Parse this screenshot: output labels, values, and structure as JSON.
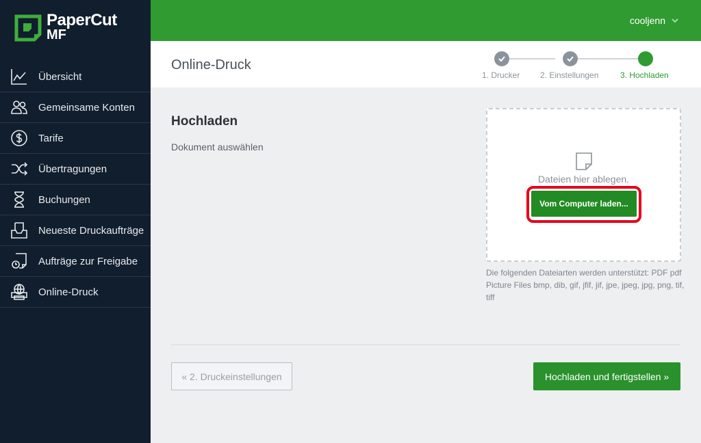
{
  "brand": {
    "name": "PaperCut",
    "product": "MF"
  },
  "user": {
    "name": "cooljenn"
  },
  "sidebar": {
    "items": [
      {
        "label": "Übersicht",
        "icon": "chart-line-icon"
      },
      {
        "label": "Gemeinsame Konten",
        "icon": "users-icon"
      },
      {
        "label": "Tarife",
        "icon": "dollar-icon"
      },
      {
        "label": "Übertragungen",
        "icon": "shuffle-icon"
      },
      {
        "label": "Buchungen",
        "icon": "hourglass-icon"
      },
      {
        "label": "Neueste Druckaufträge",
        "icon": "inbox-icon"
      },
      {
        "label": "Aufträge zur Freigabe",
        "icon": "document-release-icon"
      },
      {
        "label": "Online-Druck",
        "icon": "printer-globe-icon"
      }
    ]
  },
  "header": {
    "title": "Online-Druck",
    "steps": [
      {
        "label": "1. Drucker",
        "state": "done"
      },
      {
        "label": "2. Einstellungen",
        "state": "done"
      },
      {
        "label": "3. Hochladen",
        "state": "active"
      }
    ]
  },
  "main": {
    "title": "Hochladen",
    "subtitle": "Dokument auswählen",
    "dropzone": {
      "text": "Dateien hier ablegen.",
      "button": "Vom Computer laden..."
    },
    "filetypes": "Die folgenden Dateiarten werden unterstützt: PDF pdf Picture Files bmp, dib, gif, jfif, jif, jpe, jpeg, jpg, png, tif, tiff",
    "back_button": "« 2. Druckeinstellungen",
    "finish_button": "Hochladen und fertigstellen »"
  },
  "colors": {
    "brand_green": "#2f9b31",
    "sidebar_bg": "#111e2d",
    "highlight_red": "#e8001c"
  }
}
